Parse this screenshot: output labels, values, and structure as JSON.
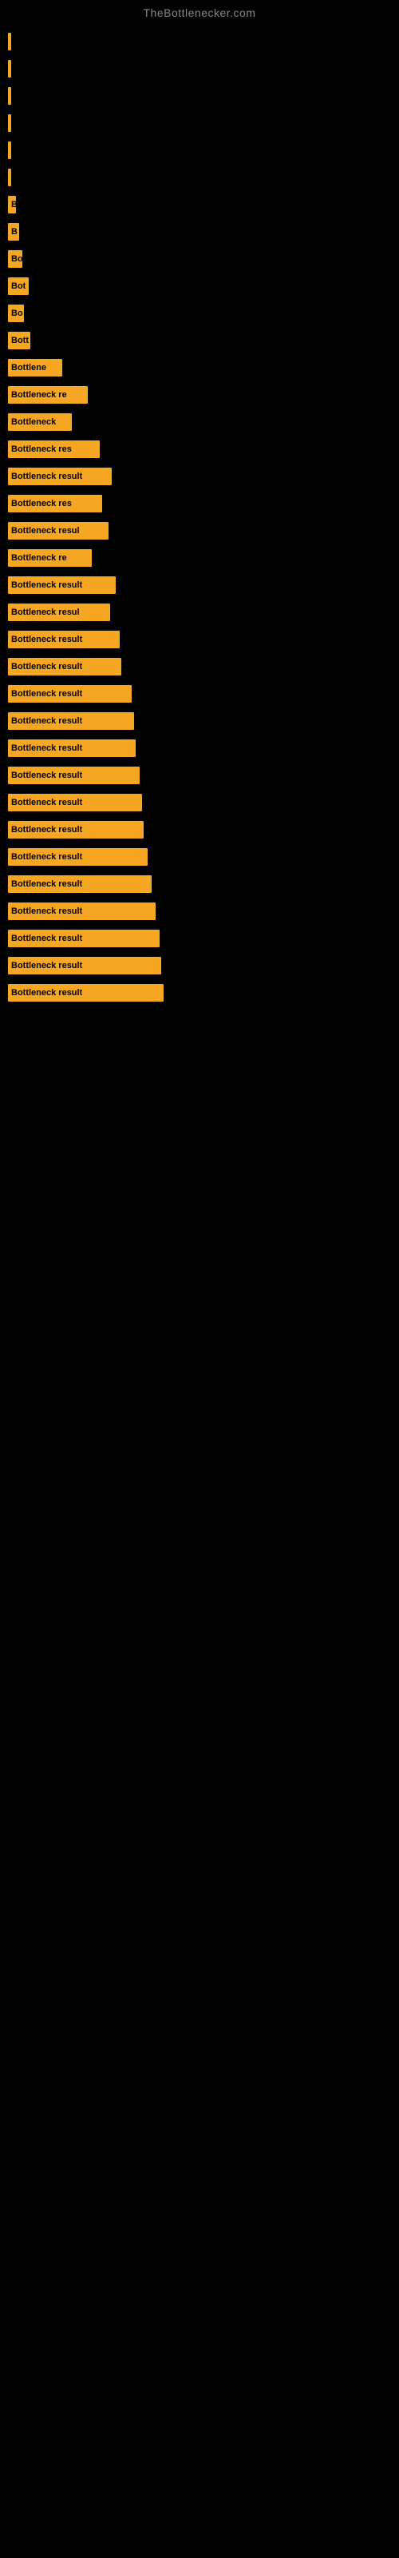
{
  "site": {
    "title": "TheBottlenecker.com"
  },
  "bars": [
    {
      "id": 1,
      "label": "",
      "width": 2
    },
    {
      "id": 2,
      "label": "",
      "width": 2
    },
    {
      "id": 3,
      "label": "",
      "width": 2
    },
    {
      "id": 4,
      "label": "",
      "width": 3
    },
    {
      "id": 5,
      "label": "",
      "width": 2
    },
    {
      "id": 6,
      "label": "",
      "width": 2
    },
    {
      "id": 7,
      "label": "B",
      "width": 10
    },
    {
      "id": 8,
      "label": "B",
      "width": 14
    },
    {
      "id": 9,
      "label": "Bo",
      "width": 18
    },
    {
      "id": 10,
      "label": "Bot",
      "width": 26
    },
    {
      "id": 11,
      "label": "Bo",
      "width": 20
    },
    {
      "id": 12,
      "label": "Bott",
      "width": 28
    },
    {
      "id": 13,
      "label": "Bottlene",
      "width": 68
    },
    {
      "id": 14,
      "label": "Bottleneck re",
      "width": 100
    },
    {
      "id": 15,
      "label": "Bottleneck",
      "width": 80
    },
    {
      "id": 16,
      "label": "Bottleneck res",
      "width": 115
    },
    {
      "id": 17,
      "label": "Bottleneck result",
      "width": 130
    },
    {
      "id": 18,
      "label": "Bottleneck res",
      "width": 118
    },
    {
      "id": 19,
      "label": "Bottleneck resul",
      "width": 126
    },
    {
      "id": 20,
      "label": "Bottleneck re",
      "width": 105
    },
    {
      "id": 21,
      "label": "Bottleneck result",
      "width": 135
    },
    {
      "id": 22,
      "label": "Bottleneck resul",
      "width": 128
    },
    {
      "id": 23,
      "label": "Bottleneck result",
      "width": 140
    },
    {
      "id": 24,
      "label": "Bottleneck result",
      "width": 142
    },
    {
      "id": 25,
      "label": "Bottleneck result",
      "width": 155
    },
    {
      "id": 26,
      "label": "Bottleneck result",
      "width": 158
    },
    {
      "id": 27,
      "label": "Bottleneck result",
      "width": 160
    },
    {
      "id": 28,
      "label": "Bottleneck result",
      "width": 165
    },
    {
      "id": 29,
      "label": "Bottleneck result",
      "width": 168
    },
    {
      "id": 30,
      "label": "Bottleneck result",
      "width": 170
    },
    {
      "id": 31,
      "label": "Bottleneck result",
      "width": 175
    },
    {
      "id": 32,
      "label": "Bottleneck result",
      "width": 180
    },
    {
      "id": 33,
      "label": "Bottleneck result",
      "width": 185
    },
    {
      "id": 34,
      "label": "Bottleneck result",
      "width": 190
    },
    {
      "id": 35,
      "label": "Bottleneck result",
      "width": 192
    },
    {
      "id": 36,
      "label": "Bottleneck result",
      "width": 195
    }
  ]
}
